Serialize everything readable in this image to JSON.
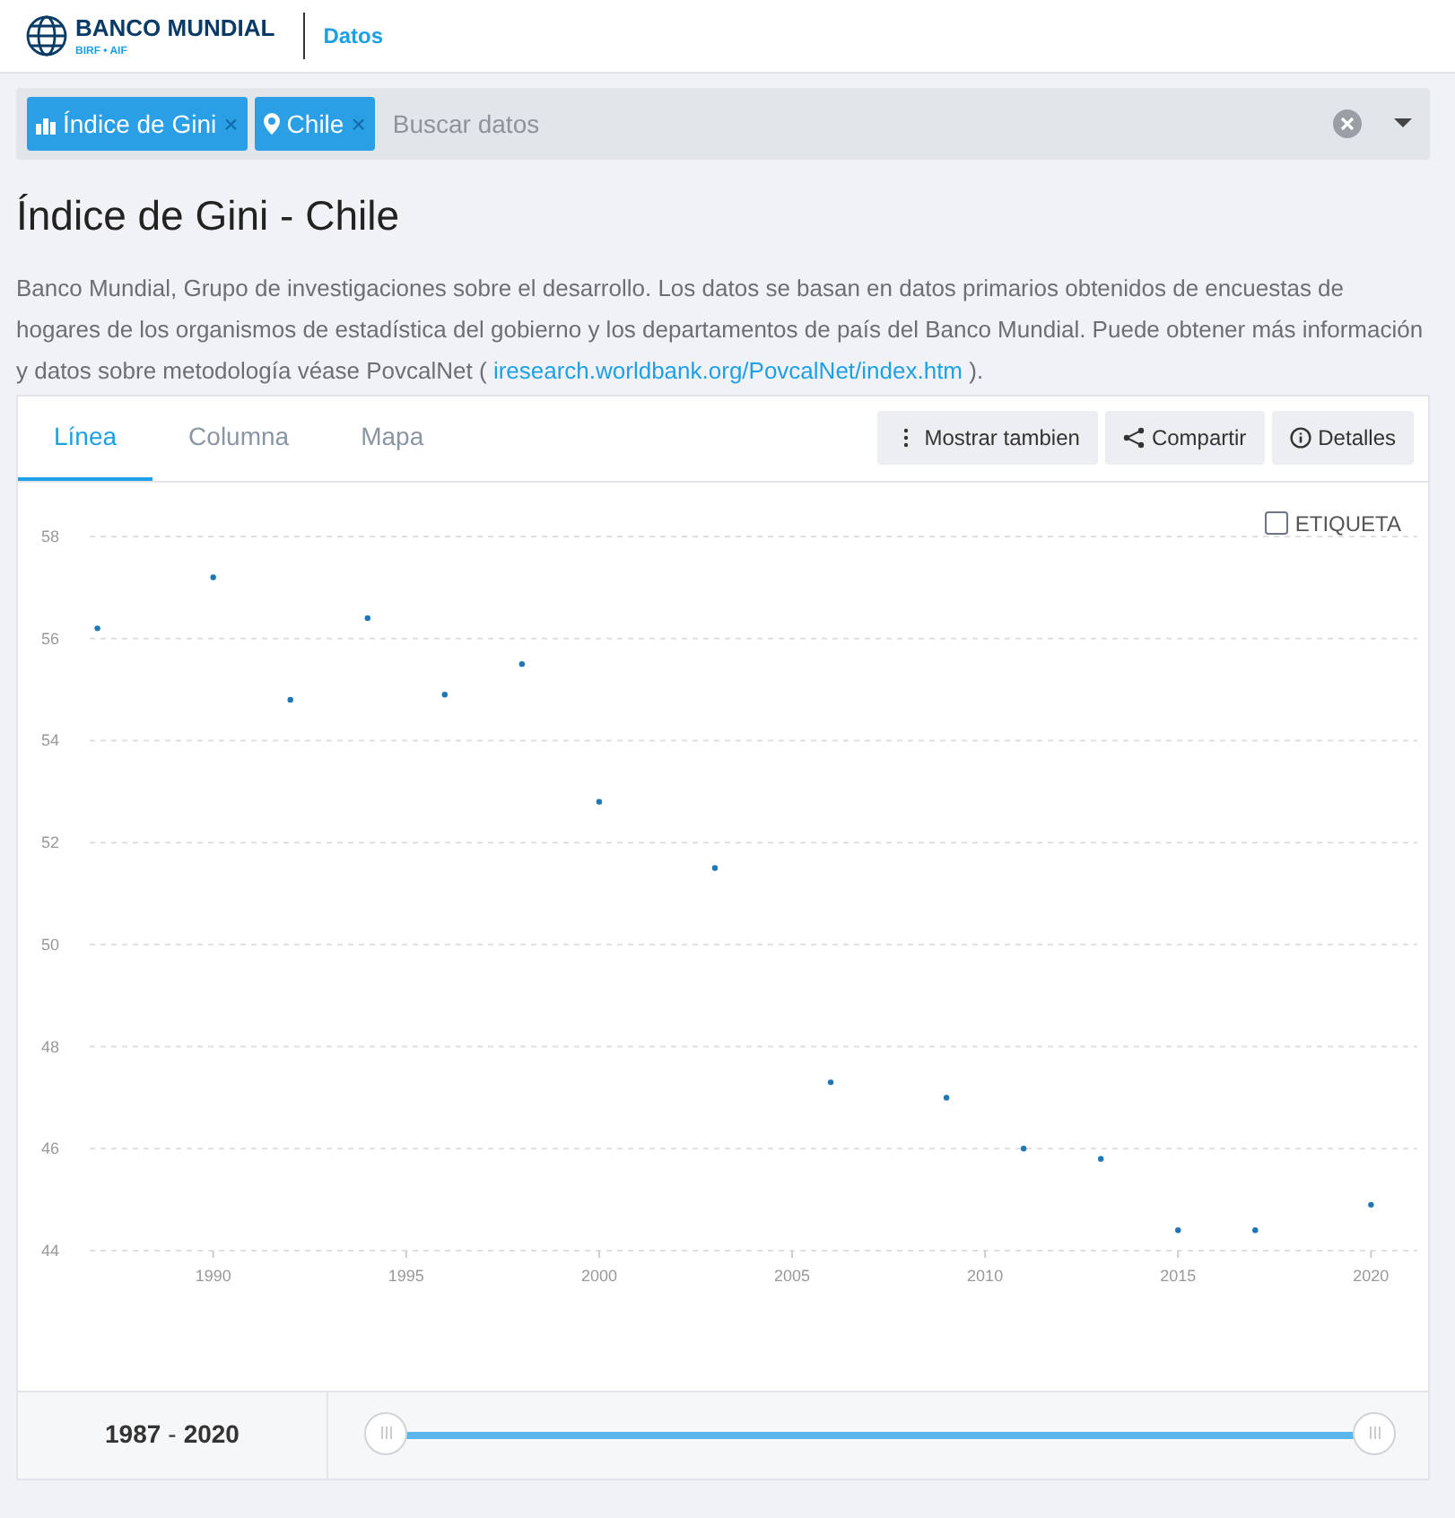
{
  "header": {
    "logo_title": "BANCO MUNDIAL",
    "logo_subtitle": "BIRF • AIF",
    "section": "Datos"
  },
  "search": {
    "tags": [
      {
        "kind": "indicator",
        "label": "Índice de Gini",
        "remove": "×"
      },
      {
        "kind": "location",
        "label": "Chile",
        "remove": "×"
      }
    ],
    "placeholder": "Buscar datos"
  },
  "title": "Índice de Gini - Chile",
  "description": "Banco Mundial, Grupo de investigaciones sobre el desarrollo. Los datos se basan en datos primarios obtenidos de encuestas de hogares de los organismos de estadística del gobierno y los departamentos de país del Banco Mundial. Puede obtener más información y datos sobre metodología véase PovcalNet ( ",
  "description_link": "iresearch.worldbank.org/PovcalNet/index.htm",
  "description_end": " ).",
  "tabs": [
    {
      "label": "Línea",
      "selected": true
    },
    {
      "label": "Columna",
      "selected": false
    },
    {
      "label": "Mapa",
      "selected": false
    }
  ],
  "actions": [
    {
      "kind": "more",
      "label": "Mostrar tambien"
    },
    {
      "kind": "share",
      "label": "Compartir"
    },
    {
      "kind": "info",
      "label": "Detalles"
    }
  ],
  "label_toggle": {
    "label": "ETIQUETA",
    "checked": false
  },
  "chart_data": {
    "type": "scatter",
    "x": [
      1987,
      1990,
      1992,
      1994,
      1996,
      1998,
      2000,
      2003,
      2006,
      2009,
      2011,
      2013,
      2015,
      2017,
      2020
    ],
    "grid": true,
    "series": [
      {
        "color": "#1f77b4",
        "values": [
          56.2,
          57.2,
          54.8,
          56.4,
          54.9,
          55.5,
          52.8,
          51.5,
          47.3,
          47.0,
          46.0,
          45.8,
          44.4,
          44.4,
          44.9
        ]
      }
    ],
    "xlim": [
      1986.8,
      2021.2
    ],
    "ylim": [
      44,
      58
    ],
    "xticks": [
      1990,
      1995,
      2000,
      2005,
      2010,
      2015,
      2020
    ],
    "yticks": [
      44,
      46,
      48,
      50,
      52,
      54,
      56,
      58
    ]
  },
  "range": {
    "start": "1987",
    "separator": "-",
    "end": "2020",
    "handles": [
      {
        "level": 0
      },
      {
        "level": 1
      }
    ]
  }
}
